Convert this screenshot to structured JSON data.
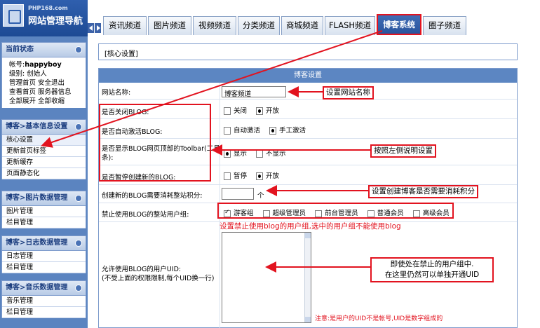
{
  "brand": {
    "site": "PHP168.com",
    "title": "网站管理导航"
  },
  "sidebar": {
    "status": {
      "title": "当前状态",
      "account_label": "帐号:",
      "account_value": "happyboy",
      "level": "级别: 创始人",
      "links1": "管理首页 安全退出",
      "links2": "查看首页 服务器信息",
      "links3": "全部展开 全部收缩"
    },
    "sections": [
      {
        "title": "博客>基本信息设置",
        "items": [
          "核心设置",
          "更新首页标签",
          "更新缓存",
          "页面静态化"
        ]
      },
      {
        "title": "博客>图片数据管理",
        "items": [
          "图片管理",
          "栏目管理"
        ]
      },
      {
        "title": "博客>日志数据管理",
        "items": [
          "日志管理",
          "栏目管理"
        ]
      },
      {
        "title": "博客>音乐数据管理",
        "items": [
          "音乐管理",
          "栏目管理"
        ]
      }
    ]
  },
  "tabs": [
    "资讯频道",
    "图片频道",
    "视频频道",
    "分类频道",
    "商城频道",
    "FLASH频道",
    "博客系统",
    "圈子频道"
  ],
  "breadcrumb": "[核心设置]",
  "panel": {
    "title": "博客设置",
    "site_name_label": "网站名称:",
    "site_name_value": "博客频道",
    "close_label": "是否关闭BLOG:",
    "close_opt_off": "关闭",
    "close_opt_on": "开放",
    "activate_label": "是否自动激活BLOG:",
    "activate_opt_auto": "自动激活",
    "activate_opt_manual": "手工激活",
    "toolbar_label_1": "是否显示BLOG网页顶部的Toolbar(工具",
    "toolbar_label_2": "条):",
    "toolbar_opt_show": "显示",
    "toolbar_opt_hide": "不显示",
    "pause_label": "是否暂停创建新的BLOG:",
    "pause_opt_pause": "暂停",
    "pause_opt_open": "开放",
    "points_label": "创建新的BLOG需要消耗整站积分:",
    "points_unit": "个",
    "groups_label": "禁止使用BLOG的整站用户组:",
    "groups": [
      {
        "name": "游客组",
        "checked": true
      },
      {
        "name": "超级管理员",
        "checked": false
      },
      {
        "name": "前台管理员",
        "checked": false
      },
      {
        "name": "普通会员",
        "checked": false
      },
      {
        "name": "高级会员",
        "checked": false
      }
    ],
    "uid_label": "允许使用BLOG的用户UID:",
    "uid_hint": "(不受上面的权限限制,每个UID换一行)",
    "uid_note": "注意:是用户的UID不是帐号,UID是数字组成的"
  },
  "annotations": {
    "site_name": "设置网站名称",
    "left_desc": "按照左侧说明设置",
    "points": "设置创建博客是否需要消耗积分",
    "groups": "设置禁止使用blog的用户组,选中的用户组不能使用blog",
    "uid_line1": "即使处在禁止的用户组中.",
    "uid_line2": "在这里仍然可以单独开通UID"
  },
  "colors": {
    "accent": "#e2131f",
    "nav": "#5b84c0",
    "panel_head": "#5c86c2"
  }
}
